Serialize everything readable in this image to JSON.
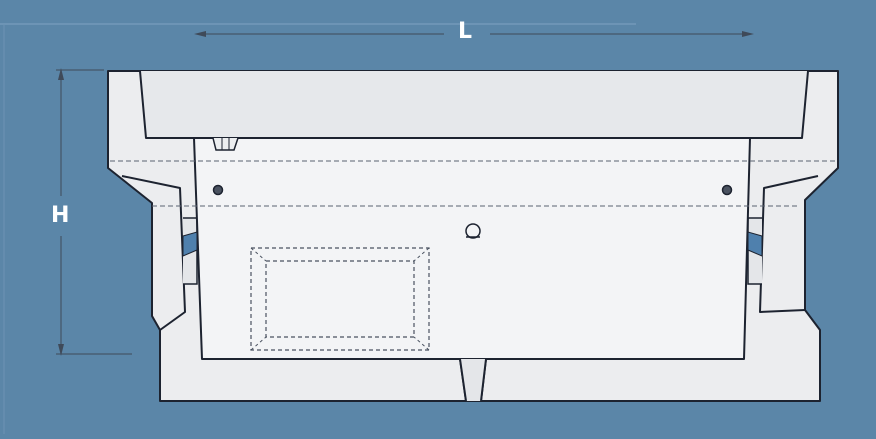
{
  "dimensions": {
    "length_label": "L",
    "height_label": "H"
  },
  "colors": {
    "background": "#5b86a8",
    "body_fill": "#ecedef",
    "inner_fill": "#f3f4f6",
    "outline": "#1d2330",
    "dim_line": "#3f4a59",
    "gap_accent": "#4f80ad",
    "label": "#ffffff"
  }
}
